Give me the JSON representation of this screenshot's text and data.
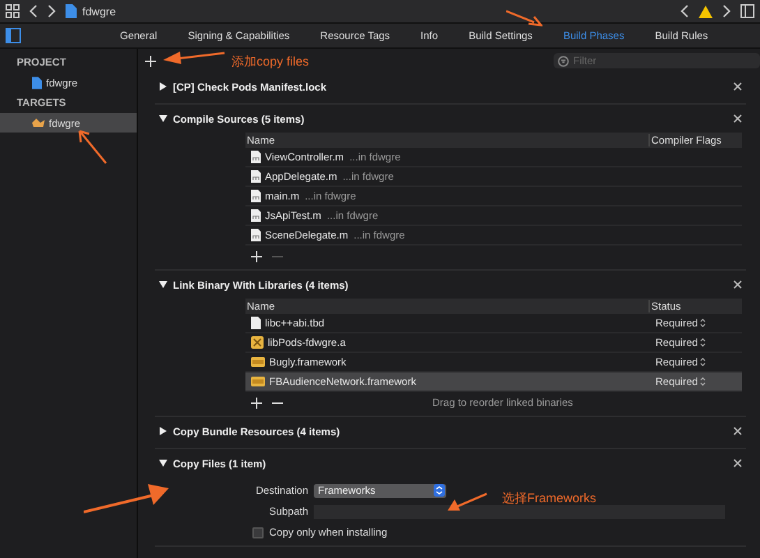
{
  "toolbar": {
    "title": "fdwgre"
  },
  "tabs": [
    {
      "label": "General",
      "selected": false
    },
    {
      "label": "Signing & Capabilities",
      "selected": false
    },
    {
      "label": "Resource Tags",
      "selected": false
    },
    {
      "label": "Info",
      "selected": false
    },
    {
      "label": "Build Settings",
      "selected": false
    },
    {
      "label": "Build Phases",
      "selected": true
    },
    {
      "label": "Build Rules",
      "selected": false
    }
  ],
  "sidebar": {
    "sections": [
      {
        "heading": "PROJECT",
        "items": [
          {
            "label": "fdwgre",
            "kind": "project",
            "selected": false
          }
        ]
      },
      {
        "heading": "TARGETS",
        "items": [
          {
            "label": "fdwgre",
            "kind": "target",
            "selected": true
          }
        ]
      }
    ]
  },
  "filter": {
    "placeholder": "Filter"
  },
  "phases": [
    {
      "title": "[CP] Check Pods Manifest.lock",
      "expanded": false
    },
    {
      "kind": "sources",
      "title": "Compile Sources (5 items)",
      "expanded": true,
      "columns": [
        "Name",
        "Compiler Flags"
      ],
      "rows": [
        {
          "name": "ViewController.m",
          "location": "...in fdwgre"
        },
        {
          "name": "AppDelegate.m",
          "location": "...in fdwgre"
        },
        {
          "name": "main.m",
          "location": "...in fdwgre"
        },
        {
          "name": "JsApiTest.m",
          "location": "...in fdwgre"
        },
        {
          "name": "SceneDelegate.m",
          "location": "...in fdwgre"
        }
      ]
    },
    {
      "kind": "libraries",
      "title": "Link Binary With Libraries (4 items)",
      "expanded": true,
      "columns": [
        "Name",
        "Status"
      ],
      "rows": [
        {
          "name": "libc++abi.tbd",
          "kind": "file",
          "status": "Required",
          "selected": false
        },
        {
          "name": "libPods-fdwgre.a",
          "kind": "archive",
          "status": "Required",
          "selected": false
        },
        {
          "name": "Bugly.framework",
          "kind": "framework",
          "status": "Required",
          "selected": false
        },
        {
          "name": "FBAudienceNetwork.framework",
          "kind": "framework",
          "status": "Required",
          "selected": true
        }
      ],
      "hint": "Drag to reorder linked binaries"
    },
    {
      "title": "Copy Bundle Resources (4 items)",
      "expanded": false
    },
    {
      "kind": "copy_files",
      "title": "Copy Files (1 item)",
      "expanded": true,
      "destination_label": "Destination",
      "destination": "Frameworks",
      "subpath_label": "Subpath",
      "option": {
        "label": "Copy only when installing",
        "checked": false
      }
    }
  ],
  "annotations": [
    {
      "text": "添加copy files"
    },
    {
      "text": "选择Frameworks"
    }
  ]
}
